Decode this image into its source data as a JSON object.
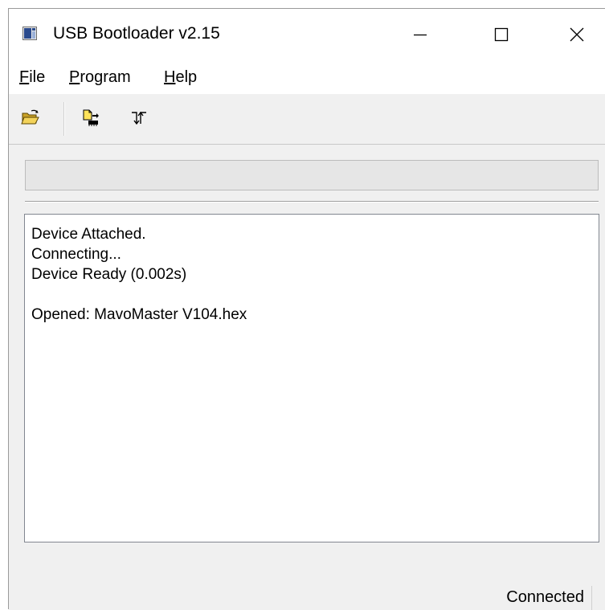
{
  "window": {
    "title": "USB Bootloader v2.15"
  },
  "title_buttons": {
    "minimize": "minimize-icon",
    "maximize": "maximize-icon",
    "close": "close-icon"
  },
  "menu": {
    "items": [
      {
        "accel": "F",
        "rest": "ile"
      },
      {
        "accel": "P",
        "rest": "rogram"
      },
      {
        "accel": "H",
        "rest": "elp"
      }
    ]
  },
  "toolbar": {
    "icons": [
      "open-folder-icon",
      "program-device-icon",
      "reset-device-icon"
    ]
  },
  "progress": {
    "value": 0
  },
  "log": {
    "lines": [
      "Device Attached.",
      "Connecting...",
      "Device Ready (0.002s)",
      "",
      "Opened: MavoMaster V104.hex"
    ]
  },
  "status": {
    "text": "Connected"
  },
  "colors": {
    "window_bg": "#f0f0f0",
    "progress_fill": "#06b025"
  }
}
